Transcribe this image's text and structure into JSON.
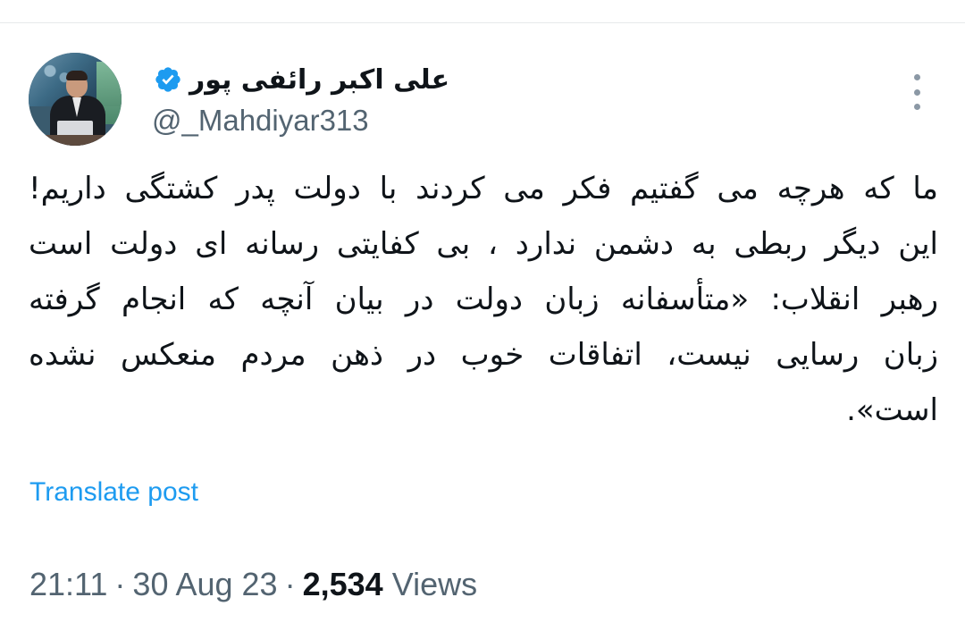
{
  "author": {
    "display_name": "علی اکبر رائفی پور",
    "handle": "@_Mahdiyar313",
    "verified": true,
    "verified_color": "#1d9bf0",
    "avatar_icon": "profile-photo"
  },
  "post": {
    "lines": [
      "ما که هرچه می گفتیم فکر می کردند با دولت پدر کشتگی داریم!",
      "این دیگر ربطی به دشمن ندارد ، بی کفایتی رسانه ای دولت است",
      "رهبر انقلاب: «متأسفانه زبان دولت در بیان آنچه که انجام گرفته",
      "زبان رسایی نیست، اتفاقات خوب در ذهن مردم منعکس نشده",
      "است»."
    ]
  },
  "actions": {
    "translate_label": "Translate post",
    "more_icon": "more-vertical-icon"
  },
  "meta": {
    "time": "21:11",
    "date": "30 Aug 23",
    "separator": "·",
    "views_count": "2,534",
    "views_label": "Views"
  },
  "colors": {
    "text": "#0f1419",
    "secondary": "#536471",
    "link": "#1d9bf0",
    "divider": "#e7e9ea"
  }
}
